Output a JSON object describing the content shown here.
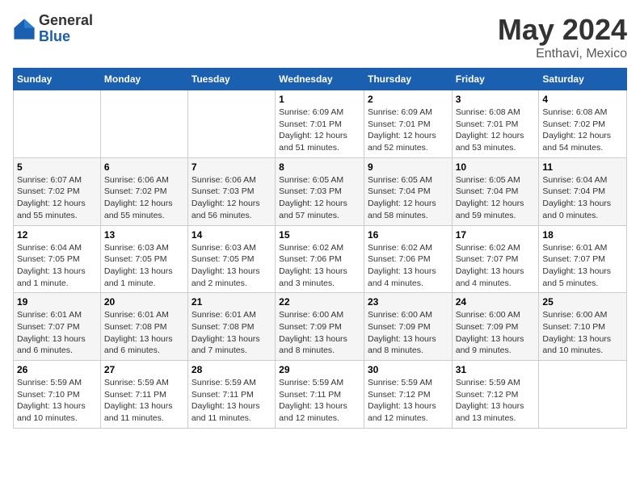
{
  "logo": {
    "general": "General",
    "blue": "Blue"
  },
  "title": {
    "month_year": "May 2024",
    "location": "Enthavi, Mexico"
  },
  "weekdays": [
    "Sunday",
    "Monday",
    "Tuesday",
    "Wednesday",
    "Thursday",
    "Friday",
    "Saturday"
  ],
  "weeks": [
    [
      {
        "day": "",
        "info": ""
      },
      {
        "day": "",
        "info": ""
      },
      {
        "day": "",
        "info": ""
      },
      {
        "day": "1",
        "info": "Sunrise: 6:09 AM\nSunset: 7:01 PM\nDaylight: 12 hours\nand 51 minutes."
      },
      {
        "day": "2",
        "info": "Sunrise: 6:09 AM\nSunset: 7:01 PM\nDaylight: 12 hours\nand 52 minutes."
      },
      {
        "day": "3",
        "info": "Sunrise: 6:08 AM\nSunset: 7:01 PM\nDaylight: 12 hours\nand 53 minutes."
      },
      {
        "day": "4",
        "info": "Sunrise: 6:08 AM\nSunset: 7:02 PM\nDaylight: 12 hours\nand 54 minutes."
      }
    ],
    [
      {
        "day": "5",
        "info": "Sunrise: 6:07 AM\nSunset: 7:02 PM\nDaylight: 12 hours\nand 55 minutes."
      },
      {
        "day": "6",
        "info": "Sunrise: 6:06 AM\nSunset: 7:02 PM\nDaylight: 12 hours\nand 55 minutes."
      },
      {
        "day": "7",
        "info": "Sunrise: 6:06 AM\nSunset: 7:03 PM\nDaylight: 12 hours\nand 56 minutes."
      },
      {
        "day": "8",
        "info": "Sunrise: 6:05 AM\nSunset: 7:03 PM\nDaylight: 12 hours\nand 57 minutes."
      },
      {
        "day": "9",
        "info": "Sunrise: 6:05 AM\nSunset: 7:04 PM\nDaylight: 12 hours\nand 58 minutes."
      },
      {
        "day": "10",
        "info": "Sunrise: 6:05 AM\nSunset: 7:04 PM\nDaylight: 12 hours\nand 59 minutes."
      },
      {
        "day": "11",
        "info": "Sunrise: 6:04 AM\nSunset: 7:04 PM\nDaylight: 13 hours\nand 0 minutes."
      }
    ],
    [
      {
        "day": "12",
        "info": "Sunrise: 6:04 AM\nSunset: 7:05 PM\nDaylight: 13 hours\nand 1 minute."
      },
      {
        "day": "13",
        "info": "Sunrise: 6:03 AM\nSunset: 7:05 PM\nDaylight: 13 hours\nand 1 minute."
      },
      {
        "day": "14",
        "info": "Sunrise: 6:03 AM\nSunset: 7:05 PM\nDaylight: 13 hours\nand 2 minutes."
      },
      {
        "day": "15",
        "info": "Sunrise: 6:02 AM\nSunset: 7:06 PM\nDaylight: 13 hours\nand 3 minutes."
      },
      {
        "day": "16",
        "info": "Sunrise: 6:02 AM\nSunset: 7:06 PM\nDaylight: 13 hours\nand 4 minutes."
      },
      {
        "day": "17",
        "info": "Sunrise: 6:02 AM\nSunset: 7:07 PM\nDaylight: 13 hours\nand 4 minutes."
      },
      {
        "day": "18",
        "info": "Sunrise: 6:01 AM\nSunset: 7:07 PM\nDaylight: 13 hours\nand 5 minutes."
      }
    ],
    [
      {
        "day": "19",
        "info": "Sunrise: 6:01 AM\nSunset: 7:07 PM\nDaylight: 13 hours\nand 6 minutes."
      },
      {
        "day": "20",
        "info": "Sunrise: 6:01 AM\nSunset: 7:08 PM\nDaylight: 13 hours\nand 6 minutes."
      },
      {
        "day": "21",
        "info": "Sunrise: 6:01 AM\nSunset: 7:08 PM\nDaylight: 13 hours\nand 7 minutes."
      },
      {
        "day": "22",
        "info": "Sunrise: 6:00 AM\nSunset: 7:09 PM\nDaylight: 13 hours\nand 8 minutes."
      },
      {
        "day": "23",
        "info": "Sunrise: 6:00 AM\nSunset: 7:09 PM\nDaylight: 13 hours\nand 8 minutes."
      },
      {
        "day": "24",
        "info": "Sunrise: 6:00 AM\nSunset: 7:09 PM\nDaylight: 13 hours\nand 9 minutes."
      },
      {
        "day": "25",
        "info": "Sunrise: 6:00 AM\nSunset: 7:10 PM\nDaylight: 13 hours\nand 10 minutes."
      }
    ],
    [
      {
        "day": "26",
        "info": "Sunrise: 5:59 AM\nSunset: 7:10 PM\nDaylight: 13 hours\nand 10 minutes."
      },
      {
        "day": "27",
        "info": "Sunrise: 5:59 AM\nSunset: 7:11 PM\nDaylight: 13 hours\nand 11 minutes."
      },
      {
        "day": "28",
        "info": "Sunrise: 5:59 AM\nSunset: 7:11 PM\nDaylight: 13 hours\nand 11 minutes."
      },
      {
        "day": "29",
        "info": "Sunrise: 5:59 AM\nSunset: 7:11 PM\nDaylight: 13 hours\nand 12 minutes."
      },
      {
        "day": "30",
        "info": "Sunrise: 5:59 AM\nSunset: 7:12 PM\nDaylight: 13 hours\nand 12 minutes."
      },
      {
        "day": "31",
        "info": "Sunrise: 5:59 AM\nSunset: 7:12 PM\nDaylight: 13 hours\nand 13 minutes."
      },
      {
        "day": "",
        "info": ""
      }
    ]
  ]
}
